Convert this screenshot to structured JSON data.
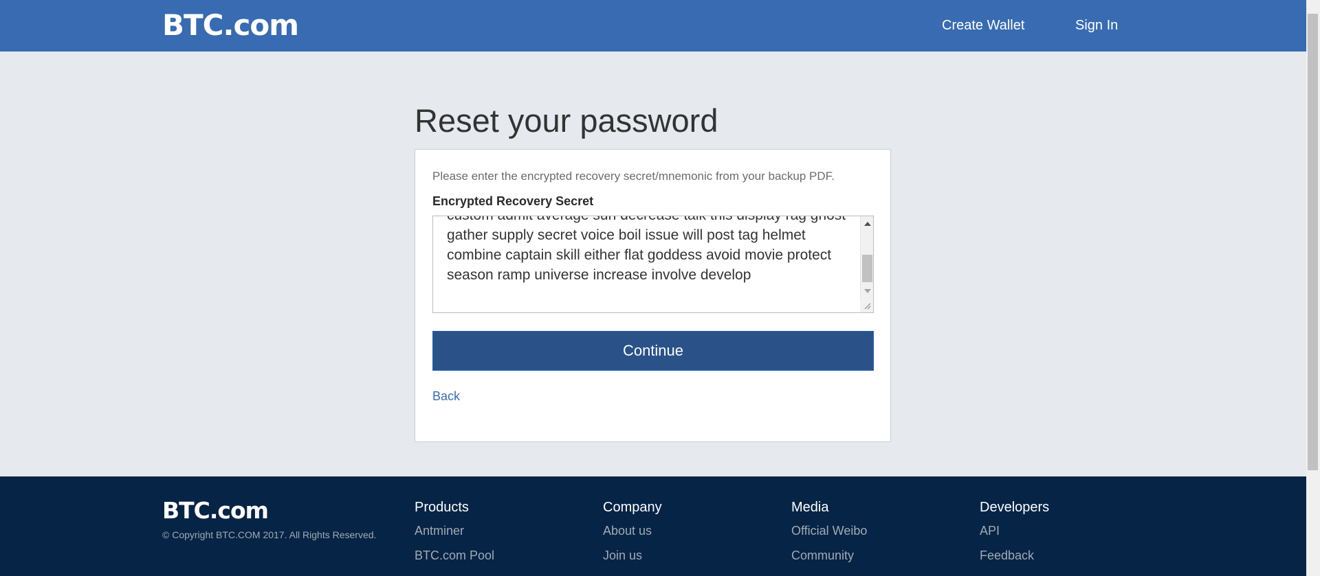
{
  "header": {
    "logo": "BTC.com",
    "nav": {
      "create_wallet": "Create Wallet",
      "sign_in": "Sign In"
    }
  },
  "main": {
    "title": "Reset your password",
    "description": "Please enter the encrypted recovery secret/mnemonic from your backup PDF.",
    "field_label": "Encrypted Recovery Secret",
    "secret_value": "custom admit average sun decrease talk this display rag ghost gather supply secret voice boil issue will post tag helmet combine captain skill either flat goddess avoid movie protect season ramp universe increase involve develop",
    "continue_label": "Continue",
    "back_label": "Back"
  },
  "footer": {
    "logo": "BTC.com",
    "copyright": "© Copyright BTC.COM 2017. All Rights Reserved.",
    "columns": [
      {
        "heading": "Products",
        "links": [
          "Antminer",
          "BTC.com Pool"
        ]
      },
      {
        "heading": "Company",
        "links": [
          "About us",
          "Join us"
        ]
      },
      {
        "heading": "Media",
        "links": [
          "Official Weibo",
          "Community"
        ]
      },
      {
        "heading": "Developers",
        "links": [
          "API",
          "Feedback"
        ]
      }
    ]
  },
  "colors": {
    "header_bg": "#386bb1",
    "page_bg": "#e6e9ee",
    "button_bg": "#2a5288",
    "footer_bg": "#062446",
    "link": "#386bb1"
  }
}
